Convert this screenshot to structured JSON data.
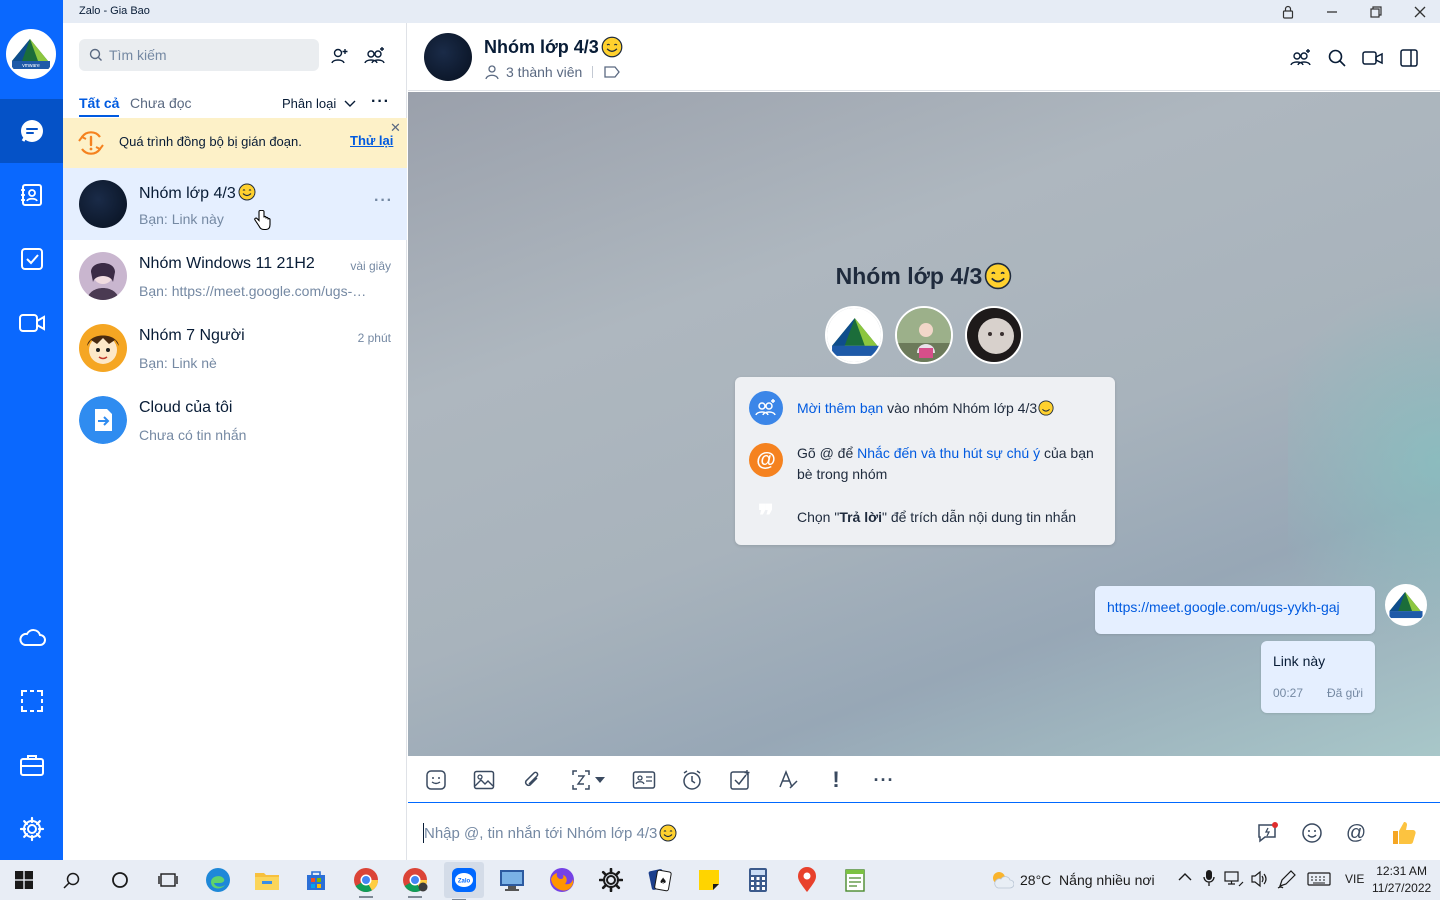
{
  "window": {
    "title": "Zalo - Gia Bao"
  },
  "sidebar": {
    "items": [
      {
        "name": "messages",
        "icon": "chat-bubble-icon"
      },
      {
        "name": "contacts",
        "icon": "contact-book-icon"
      },
      {
        "name": "todo",
        "icon": "checkbox-icon"
      },
      {
        "name": "video",
        "icon": "video-camera-icon"
      },
      {
        "name": "cloud",
        "icon": "cloud-icon"
      },
      {
        "name": "screenshot",
        "icon": "capture-frame-icon"
      },
      {
        "name": "toolbox",
        "icon": "briefcase-icon"
      },
      {
        "name": "settings",
        "icon": "gear-icon"
      }
    ]
  },
  "list": {
    "search_placeholder": "Tìm kiếm",
    "tabs": {
      "all": "Tất cả",
      "unread": "Chưa đọc"
    },
    "classify_label": "Phân loại",
    "sync_banner": {
      "message": "Quá trình đồng bộ bị gián đoạn.",
      "retry": "Thử lại"
    },
    "conversations": [
      {
        "name": "Nhóm lớp 4/3",
        "preview": "Bạn: Link này",
        "time": ""
      },
      {
        "name": "Nhóm Windows 11 21H2",
        "preview": "Bạn: https://meet.google.com/ugs-yykh-gaj",
        "time": "vài giây"
      },
      {
        "name": "Nhóm 7 Người",
        "preview": "Bạn: Link nè",
        "time": "2 phút"
      },
      {
        "name": "Cloud của tôi",
        "preview": "Chưa có tin nhắn",
        "time": ""
      }
    ]
  },
  "chat": {
    "title": "Nhóm lớp 4/3",
    "members": "3 thành viên",
    "intro_title": "Nhóm lớp 4/3",
    "tips": {
      "invite_link": "Mời thêm bạn",
      "invite_rest": " vào nhóm Nhóm lớp 4/3",
      "mention_prefix": "Gõ @ để ",
      "mention_link": "Nhắc đến và thu hút sự chú ý",
      "mention_rest": " của bạn bè trong nhóm",
      "reply_prefix": "Chọn \"",
      "reply_bold": "Trả lời",
      "reply_rest": "\" để trích dẫn nội dung tin nhắn"
    },
    "messages": [
      {
        "text": "https://meet.google.com/ugs-yykh-gaj"
      },
      {
        "text": "Link này",
        "time": "00:27",
        "status": "Đã gửi"
      }
    ],
    "input_placeholder": "Nhập @, tin nhắn tới Nhóm lớp 4/3"
  },
  "taskbar": {
    "weather": "28°C  Nắng nhiều nơi",
    "language": "VIE",
    "time": "12:31 AM",
    "date": "11/27/2022"
  },
  "colors": {
    "primary": "#0068ff",
    "nav_bg": "#0a68fe",
    "banner_bg": "#fdf1c8",
    "selected_bg": "#e5efff"
  }
}
